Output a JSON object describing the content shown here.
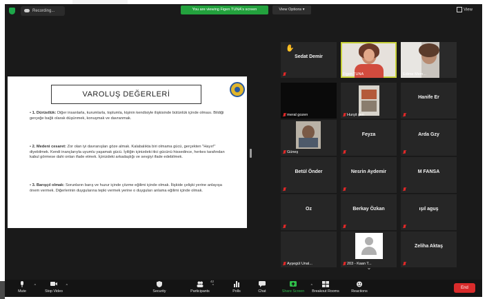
{
  "topbar": {
    "recording_label": "Recording...",
    "banner": "You are viewing Figen TUNA's screen",
    "view_options": "View Options",
    "view_label": "View"
  },
  "slide": {
    "title": "VAROLUŞ DEĞERLERİ",
    "items": [
      {
        "number": "1. Dürüstlük:",
        "text": "Diğer insanlarla, kurumlarla, toplumla, kişinin kendisiyle ilişkisinde bütünlük içinde olması. Bildiği gerçeğe bağlı olarak düşünmek, konuşmak ve davranmak."
      },
      {
        "number": "2. Medeni cesaret:",
        "text": "Zor olan iyi davranışları göze almak. Kalabalıkta biri olmama gücü, gerçekten \"Hayır!\" diyebilmek. Kendi inançlarıyla uyumlu yaşamak gücü. İyiliğin içinizdeki itici gücünü hissedince, herkes tarafından kabul görmese dahi onları ifade etmek. İçinizdeki arkadaşlığı ve sevgiyi ifade edebilmek."
      },
      {
        "number": "3. Barışçıl olmak:",
        "text": "Sorunların barış ve huzur içinde çözme eğilimi içinde olmak. İlişkide çelişki yerine anlayışa önem vermek. Diğerlerinin duygularına tepki vermek yerine o duyguları anlama eğilimi içinde olmak."
      }
    ]
  },
  "participants": [
    {
      "name": "Sedat Demir",
      "muted": true,
      "raised_hand": true
    },
    {
      "name": "Figen TUNA",
      "video": true
    },
    {
      "name": "Edime Mem...",
      "video": true
    },
    {
      "name": "meral gozen",
      "muted": true
    },
    {
      "name": "Hurşit şen",
      "video": true,
      "muted": true
    },
    {
      "name": "Hanife Er",
      "muted": true
    },
    {
      "name": "Güneş",
      "video": true,
      "muted": true
    },
    {
      "name": "Feyza",
      "muted": true
    },
    {
      "name": "Arda Gzy",
      "muted": true
    },
    {
      "name": "Betül Önder",
      "muted": true
    },
    {
      "name": "Nesrin Aydemir",
      "muted": true
    },
    {
      "name": "M FANSA",
      "muted": true
    },
    {
      "name": "Oz",
      "muted": true
    },
    {
      "name": "Berkay Özkan",
      "muted": true
    },
    {
      "name": "ışıl aguş",
      "muted": true
    },
    {
      "name": "Ayşegül Ünal...",
      "muted": true
    },
    {
      "name": "203 - Kaan T...",
      "muted": true,
      "avatar": true
    },
    {
      "name": "Zeliha Aktaş",
      "muted": true
    }
  ],
  "toolbar": {
    "mute": "Mute",
    "stop_video": "Stop Video",
    "security": "Security",
    "participants": "Participants",
    "participants_count": "42",
    "polls": "Polls",
    "chat": "Chat",
    "share_screen": "Share Screen",
    "breakout_rooms": "Breakout Rooms",
    "reactions": "Reactions",
    "end": "End"
  },
  "colors": {
    "banner_green": "#23a13d",
    "end_red": "#d92b2b",
    "active_speaker": "#c9d23a",
    "muted_red": "#e02828"
  }
}
